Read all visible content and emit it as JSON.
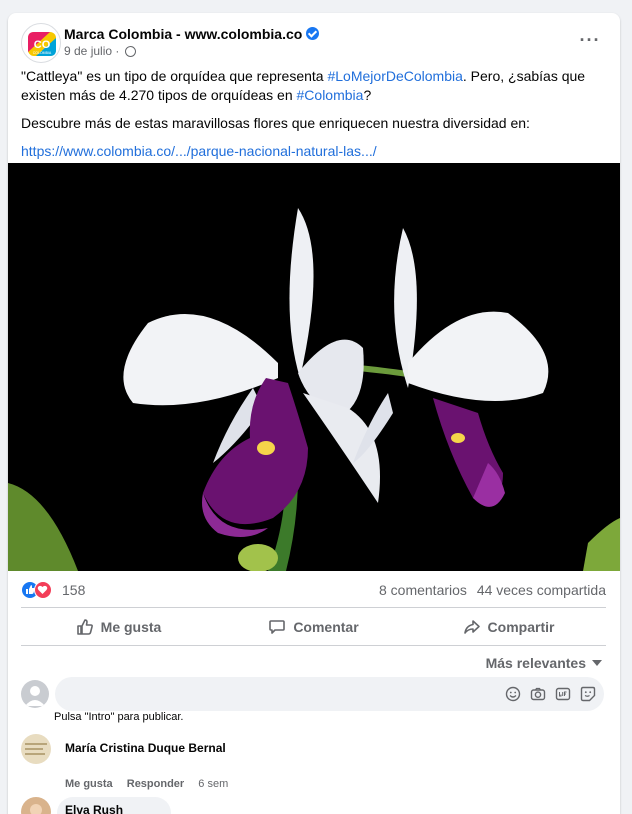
{
  "post": {
    "page_name": "Marca Colombia - www.colombia.co",
    "date": "9 de julio",
    "date_sep": " · ",
    "text_line1_prefix": "\"Cattleya\" es un tipo de orquídea que representa ",
    "hashtag1": "#LoMejorDeColombia",
    "text_line1_suffix": ". Pero, ¿sabías que existen más de 4.270 tipos de orquídeas en ",
    "hashtag2": "#Colombia",
    "text_line1_end": "?",
    "text_line2": "Descubre más de estas maravillosas flores que enriquecen nuestra diversidad en:",
    "url": "https://www.colombia.co/.../parque-nacional-natural-las.../",
    "logo_text": "CO",
    "logo_subtext": "COLOMBIA"
  },
  "stats": {
    "reactions": "158",
    "comments": "8 comentarios",
    "shares": "44 veces compartida"
  },
  "actions": {
    "like": "Me gusta",
    "comment": "Comentar",
    "share": "Compartir"
  },
  "sort": {
    "label": "Más relevantes"
  },
  "composer": {
    "placeholder": "",
    "hint": "Pulsa \"Intro\" para publicar."
  },
  "comments": [
    {
      "author": "María Cristina Duque Bernal",
      "like": "Me gusta",
      "reply": "Responder",
      "time": "6 sem"
    },
    {
      "author": "Elva Rush"
    }
  ],
  "colors": {
    "accent": "#1877f2",
    "link": "#216fdb",
    "secondary_text": "#65676b",
    "background": "#f0f2f5",
    "love": "#f33e58"
  }
}
